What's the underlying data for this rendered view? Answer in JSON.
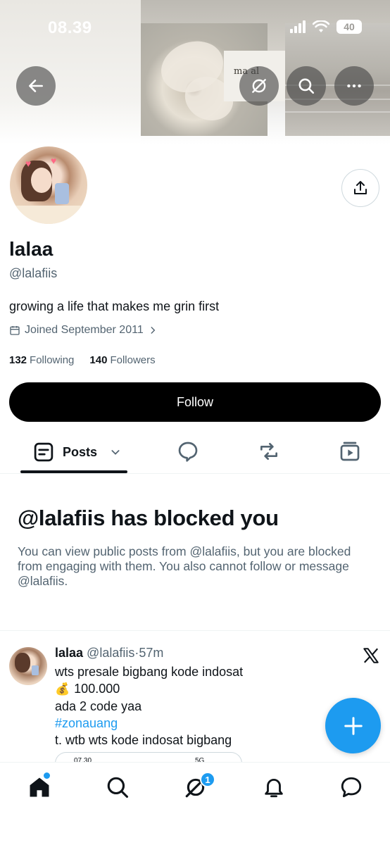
{
  "status_bar": {
    "time": "08.39",
    "battery": "40"
  },
  "header": {
    "banner_texts": {
      "label_card": "ma       al"
    },
    "buttons": [
      "back-arrow-icon",
      "grok-icon",
      "search-icon",
      "more-icon"
    ]
  },
  "profile": {
    "name": "lalaa",
    "handle": "@lalafiis",
    "bio": "growing a life that makes me grin first",
    "joined": "Joined September 2011",
    "following_count": "132",
    "following_label": "Following",
    "followers_count": "140",
    "followers_label": "Followers",
    "follow_button": "Follow"
  },
  "tabs": {
    "active_label": "Posts",
    "icons": [
      "posts-icon",
      "replies-icon",
      "reposts-icon",
      "media-icon"
    ]
  },
  "blocked": {
    "title": "@lalafiis has blocked you",
    "description": "You can view public posts from @lalafiis, but you are blocked from engaging with them. You also cannot follow or message @lalafiis."
  },
  "post": {
    "name": "lalaa",
    "handle": "@lalafiis",
    "separator": "·",
    "time": "57m",
    "lines": {
      "line1": "wts presale bigbang kode indosat",
      "money_emoji": "💰",
      "line2": "100.000",
      "line3": "ada 2 code yaa",
      "hashtag": "#zonauang",
      "line4": "t. wtb wts kode indosat bigbang"
    },
    "media_preview": {
      "time": "07.30",
      "signal": "5G"
    }
  },
  "bottom_nav": {
    "items": [
      "home-icon",
      "search-icon",
      "grok-icon",
      "notifications-icon",
      "messages-icon"
    ],
    "badge": "1"
  },
  "colors": {
    "accent": "#1d9bf0",
    "text_primary": "#0f1419",
    "text_secondary": "#536471",
    "follow_button_bg": "#000000"
  }
}
